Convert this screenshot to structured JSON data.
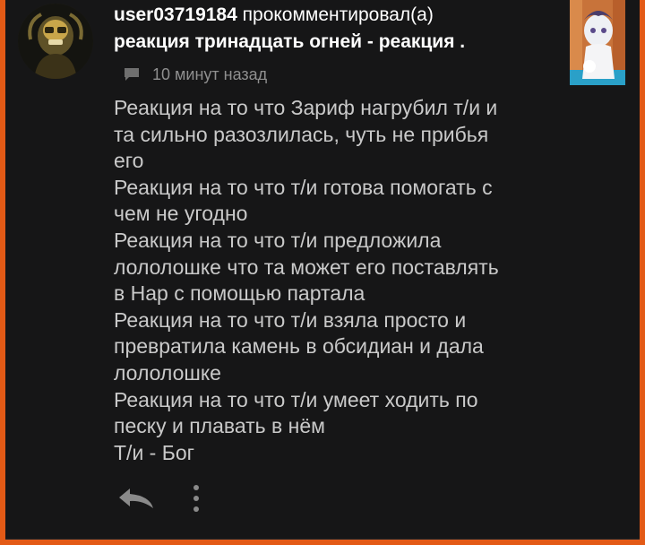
{
  "comment": {
    "username": "user03719184",
    "action": "прокомментировал(а)",
    "post_title": "реакция тринадцать огней - реакция .",
    "timestamp": "10 минут назад",
    "lines": [
      "Реакция на то что Зариф нагрубил т/и и",
      "та сильно разозлилась, чуть не прибья",
      "его",
      "Реакция на то что т/и готова помогать с",
      "чем не угодно",
      "Реакция на то что т/и предложила",
      "лололошке что та может его поставлять",
      "в Нар с помощью партала",
      "Реакция на то что т/и взяла просто и",
      "превратила камень в обсидиан и дала",
      "лололошке",
      "Реакция на то что т/и умеет ходить по",
      "песку и плавать в нём",
      "Т/и - Бог"
    ]
  },
  "icons": {
    "comment": "comment-bubble-icon",
    "reply": "reply-arrow-icon",
    "more": "more-vertical-icon"
  },
  "colors": {
    "background": "#161617",
    "accent_edge": "#e35a16",
    "title_text": "#ffffff",
    "body_text": "#c9c9c9",
    "meta_text": "#8f8f8f",
    "icon": "#8a8a8a"
  }
}
